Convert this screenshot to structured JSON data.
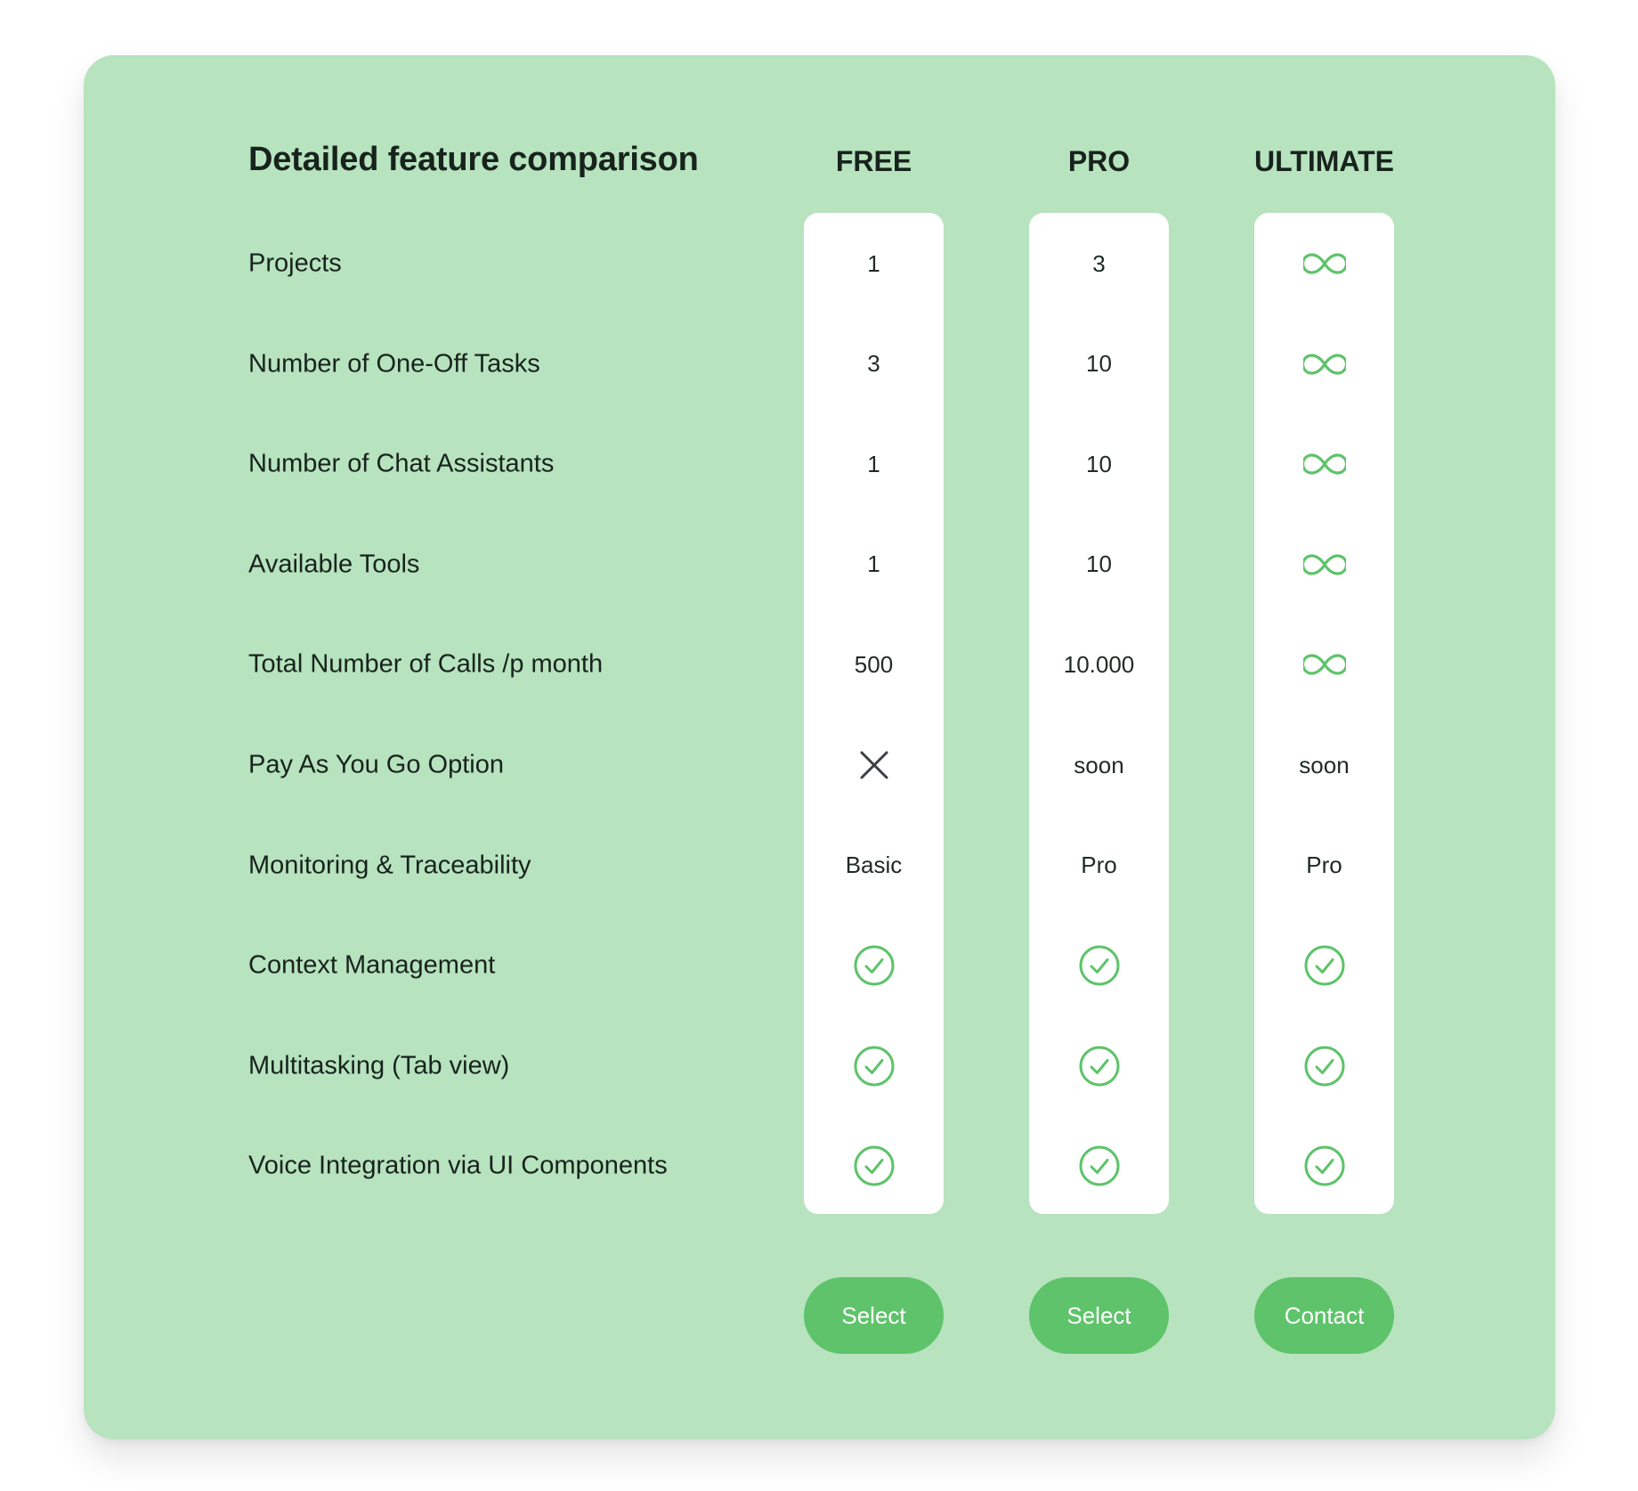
{
  "title": "Detailed feature comparison",
  "colors": {
    "card_background": "#b7e3bf",
    "accent": "#5ec36a",
    "icon_green": "#5ec36a",
    "cross": "#3a3f45"
  },
  "plans": [
    {
      "name": "FREE",
      "cta_label": "Select"
    },
    {
      "name": "PRO",
      "cta_label": "Select"
    },
    {
      "name": "ULTIMATE",
      "cta_label": "Contact"
    }
  ],
  "features": [
    {
      "label": "Projects",
      "values": [
        {
          "type": "text",
          "text": "1"
        },
        {
          "type": "text",
          "text": "3"
        },
        {
          "type": "icon",
          "icon": "infinity-icon"
        }
      ]
    },
    {
      "label": "Number of One-Off Tasks",
      "values": [
        {
          "type": "text",
          "text": "3"
        },
        {
          "type": "text",
          "text": "10"
        },
        {
          "type": "icon",
          "icon": "infinity-icon"
        }
      ]
    },
    {
      "label": "Number of Chat Assistants",
      "values": [
        {
          "type": "text",
          "text": "1"
        },
        {
          "type": "text",
          "text": "10"
        },
        {
          "type": "icon",
          "icon": "infinity-icon"
        }
      ]
    },
    {
      "label": "Available Tools",
      "values": [
        {
          "type": "text",
          "text": "1"
        },
        {
          "type": "text",
          "text": "10"
        },
        {
          "type": "icon",
          "icon": "infinity-icon"
        }
      ]
    },
    {
      "label": "Total Number of Calls /p month",
      "values": [
        {
          "type": "text",
          "text": "500"
        },
        {
          "type": "text",
          "text": "10.000"
        },
        {
          "type": "icon",
          "icon": "infinity-icon"
        }
      ]
    },
    {
      "label": "Pay As You Go Option",
      "values": [
        {
          "type": "icon",
          "icon": "cross-icon"
        },
        {
          "type": "text",
          "text": "soon"
        },
        {
          "type": "text",
          "text": "soon"
        }
      ]
    },
    {
      "label": "Monitoring & Traceability",
      "values": [
        {
          "type": "text",
          "text": "Basic"
        },
        {
          "type": "text",
          "text": "Pro"
        },
        {
          "type": "text",
          "text": "Pro"
        }
      ]
    },
    {
      "label": "Context Management",
      "values": [
        {
          "type": "icon",
          "icon": "check-circle-icon"
        },
        {
          "type": "icon",
          "icon": "check-circle-icon"
        },
        {
          "type": "icon",
          "icon": "check-circle-icon"
        }
      ]
    },
    {
      "label": "Multitasking (Tab view)",
      "values": [
        {
          "type": "icon",
          "icon": "check-circle-icon"
        },
        {
          "type": "icon",
          "icon": "check-circle-icon"
        },
        {
          "type": "icon",
          "icon": "check-circle-icon"
        }
      ]
    },
    {
      "label": "Voice Integration via UI Components",
      "values": [
        {
          "type": "icon",
          "icon": "check-circle-icon"
        },
        {
          "type": "icon",
          "icon": "check-circle-icon"
        },
        {
          "type": "icon",
          "icon": "check-circle-icon"
        }
      ]
    }
  ]
}
